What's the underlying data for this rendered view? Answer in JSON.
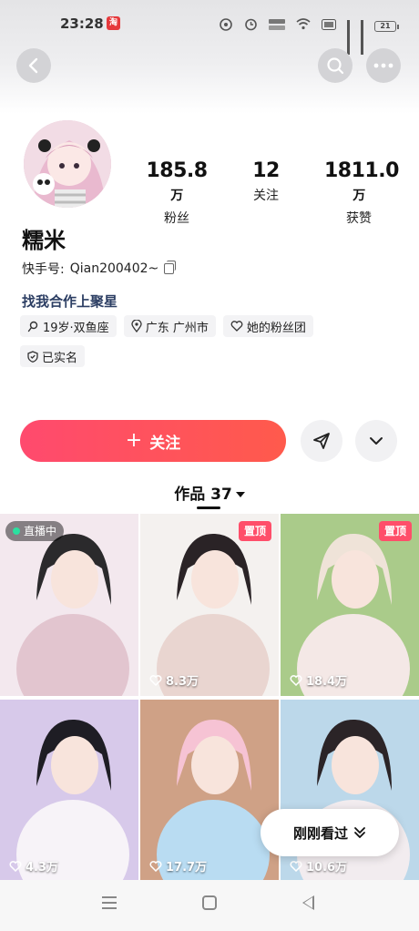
{
  "status_bar": {
    "time": "23:28",
    "app_badge": "淘",
    "battery": "21"
  },
  "header": {
    "back_icon": "chevron-left-icon",
    "search_icon": "search-icon",
    "more_icon": "more-dots-icon"
  },
  "profile": {
    "stats": [
      {
        "value": "185.8",
        "unit": "万",
        "label": "粉丝"
      },
      {
        "value": "12",
        "unit": "",
        "label": "关注"
      },
      {
        "value": "1811.0",
        "unit": "万",
        "label": "获赞"
      }
    ],
    "name": "糯米",
    "id_prefix": "快手号: ",
    "id_value": "Qian200402~",
    "cooperate_link": "找我合作上聚星",
    "tags": [
      {
        "icon": "search-person-icon",
        "text": "19岁·双鱼座"
      },
      {
        "icon": "location-pin-icon",
        "text": "广东 广州市"
      },
      {
        "icon": "heart-outline-icon",
        "text": "她的粉丝团"
      },
      {
        "icon": "verified-shield-icon",
        "text": "已实名"
      }
    ]
  },
  "actions": {
    "follow_plus": "+",
    "follow_label": "关注",
    "share_icon": "share-send-icon",
    "expand_icon": "chevron-down-icon"
  },
  "works": {
    "label": "作品 37"
  },
  "grid": [
    {
      "badge_type": "live",
      "badge": "直播中",
      "likes": "",
      "palette": [
        "#f3e8ee",
        "#e2c5cf",
        "#2b2a2c"
      ]
    },
    {
      "badge_type": "top",
      "badge": "置顶",
      "likes": "8.3万",
      "palette": [
        "#f4f1ef",
        "#e9d5d0",
        "#2a2326"
      ]
    },
    {
      "badge_type": "top",
      "badge": "置顶",
      "likes": "18.4万",
      "palette": [
        "#aacb8a",
        "#f4e8e6",
        "#efe3d8"
      ]
    },
    {
      "badge_type": "",
      "badge": "",
      "likes": "4.3万",
      "palette": [
        "#d7c9ea",
        "#f7f3f8",
        "#1e1d24"
      ]
    },
    {
      "badge_type": "",
      "badge": "",
      "likes": "17.7万",
      "palette": [
        "#cfa186",
        "#b9dcf2",
        "#f6c3d4"
      ]
    },
    {
      "badge_type": "",
      "badge": "",
      "likes": "10.6万",
      "palette": [
        "#bcd8ea",
        "#f2ecef",
        "#2b2427"
      ]
    }
  ],
  "recent": {
    "label": "刚刚看过",
    "icon": "double-chevron-down-icon"
  },
  "nav": {
    "menu_icon": "menu-lines-icon",
    "home_icon": "home-square-icon",
    "back_icon": "back-triangle-icon"
  }
}
